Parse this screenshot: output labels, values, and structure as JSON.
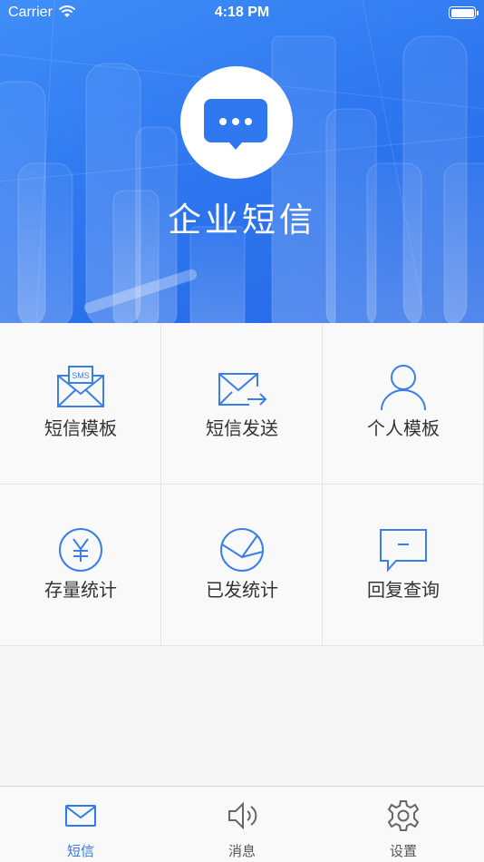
{
  "status_bar": {
    "carrier": "Carrier",
    "time": "4:18 PM"
  },
  "header": {
    "title": "企业短信",
    "background_color": "#2f78f0"
  },
  "menu": [
    {
      "label": "短信模板",
      "icon": "sms-envelope-icon"
    },
    {
      "label": "短信发送",
      "icon": "send-mail-icon"
    },
    {
      "label": "个人模板",
      "icon": "person-icon"
    },
    {
      "label": "存量统计",
      "icon": "yen-circle-icon"
    },
    {
      "label": "已发统计",
      "icon": "pie-chart-icon"
    },
    {
      "label": "回复查询",
      "icon": "reply-bubble-icon"
    }
  ],
  "sms_icon_text": "SMS",
  "tabs": [
    {
      "label": "短信",
      "icon": "mail-icon",
      "active": true
    },
    {
      "label": "消息",
      "icon": "speaker-icon",
      "active": false
    },
    {
      "label": "设置",
      "icon": "gear-icon",
      "active": false
    }
  ],
  "colors": {
    "accent": "#2f78f0",
    "icon_blue": "#3a7ee8",
    "inactive_tab": "#555555"
  }
}
